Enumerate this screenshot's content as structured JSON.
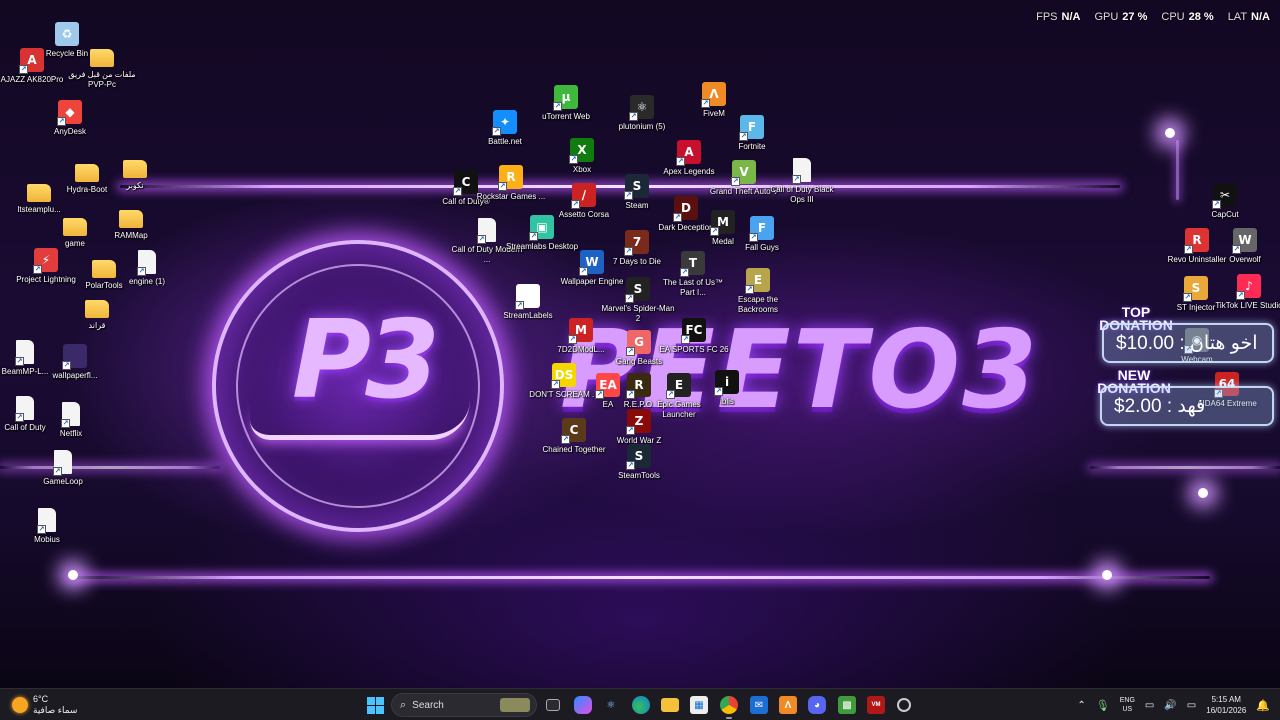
{
  "osd": {
    "fps_label": "FPS",
    "fps_value": "N/A",
    "gpu_label": "GPU",
    "gpu_value": "27 %",
    "cpu_label": "CPU",
    "cpu_value": "28 %",
    "lat_label": "LAT",
    "lat_value": "N/A"
  },
  "wallpaper": {
    "logo": "P3",
    "banner": "PEETO3"
  },
  "donations": {
    "top_title_1": "TOP",
    "top_title_2": "DONATION",
    "top_text": "اخو هتان : 10.00$",
    "new_title_1": "NEW",
    "new_title_2": "DONATION",
    "new_text": "فهد : 2.00$"
  },
  "desktop_icons": [
    {
      "label": "Recycle Bin",
      "icon": "recycle-bin-icon",
      "color": "#9ec9ea",
      "glyph": "♻"
    },
    {
      "label": "ملفات من قبل فريق PVP-Pc",
      "icon": "folder-icon",
      "color": "#f0b43a",
      "glyph": ""
    },
    {
      "label": "AJAZZ AK820Pro",
      "icon": "ajazz-icon",
      "color": "#d93232",
      "glyph": "A"
    },
    {
      "label": "AnyDesk",
      "icon": "anydesk-icon",
      "color": "#ef443b",
      "glyph": "◆"
    },
    {
      "label": "Hydra-Boot",
      "icon": "folder-icon",
      "color": "#f0b43a",
      "glyph": ""
    },
    {
      "label": "نكوبر",
      "icon": "folder-icon",
      "color": "#f0b43a",
      "glyph": ""
    },
    {
      "label": "Itsteamplu...",
      "icon": "folder-icon",
      "color": "#f0b43a",
      "glyph": ""
    },
    {
      "label": "game",
      "icon": "folder-icon",
      "color": "#f0b43a",
      "glyph": ""
    },
    {
      "label": "RAMMap",
      "icon": "folder-icon",
      "color": "#f0b43a",
      "glyph": ""
    },
    {
      "label": "Project Lightning",
      "icon": "project-lightning-icon",
      "color": "#e23d3d",
      "glyph": "⚡"
    },
    {
      "label": "PolarTools",
      "icon": "folder-icon",
      "color": "#f0b43a",
      "glyph": ""
    },
    {
      "label": "engine (1)",
      "icon": "file-icon",
      "color": "#f4f4f4",
      "glyph": ""
    },
    {
      "label": "قراند",
      "icon": "folder-icon",
      "color": "#f0b43a",
      "glyph": ""
    },
    {
      "label": "BeamMP-L...",
      "icon": "file-icon",
      "color": "#f4f4f4",
      "glyph": ""
    },
    {
      "label": "wallpaperfl...",
      "icon": "wallpaper-image-icon",
      "color": "#3a2a6a",
      "glyph": ""
    },
    {
      "label": "Call of Duty",
      "icon": "file-icon",
      "color": "#f4f4f4",
      "glyph": ""
    },
    {
      "label": "Netflix",
      "icon": "file-icon",
      "color": "#f4f4f4",
      "glyph": ""
    },
    {
      "label": "GameLoop",
      "icon": "file-icon",
      "color": "#f4f4f4",
      "glyph": ""
    },
    {
      "label": "Mobius",
      "icon": "file-icon",
      "color": "#f4f4f4",
      "glyph": ""
    },
    {
      "label": "uTorrent Web",
      "icon": "utorrent-icon",
      "color": "#3fb93c",
      "glyph": "µ"
    },
    {
      "label": "plutonium (5)",
      "icon": "plutonium-icon",
      "color": "#2a2a2a",
      "glyph": "⚛"
    },
    {
      "label": "FiveM",
      "icon": "fivem-icon",
      "color": "#f08a24",
      "glyph": "Λ"
    },
    {
      "label": "Battle.net",
      "icon": "battlenet-icon",
      "color": "#148eff",
      "glyph": "✦"
    },
    {
      "label": "Fortnite",
      "icon": "fortnite-icon",
      "color": "#5bb8e8",
      "glyph": "F"
    },
    {
      "label": "Xbox",
      "icon": "xbox-icon",
      "color": "#107c10",
      "glyph": "X"
    },
    {
      "label": "Apex Legends",
      "icon": "apex-icon",
      "color": "#c8102e",
      "glyph": "A"
    },
    {
      "label": "Call of Duty®",
      "icon": "cod-icon",
      "color": "#111111",
      "glyph": "C"
    },
    {
      "label": "Rockstar Games ...",
      "icon": "rockstar-icon",
      "color": "#fcaf17",
      "glyph": "R"
    },
    {
      "label": "Assetto Corsa",
      "icon": "assetto-icon",
      "color": "#c22",
      "glyph": "/"
    },
    {
      "label": "Steam",
      "icon": "steam-icon",
      "color": "#1b2838",
      "glyph": "S"
    },
    {
      "label": "Grand Theft Auto V",
      "icon": "gta-icon",
      "color": "#7ab648",
      "glyph": "V"
    },
    {
      "label": "Call of Duty Black Ops III",
      "icon": "file-icon",
      "color": "#f4f4f4",
      "glyph": ""
    },
    {
      "label": "Call of Duty Modern ...",
      "icon": "file-icon",
      "color": "#f4f4f4",
      "glyph": ""
    },
    {
      "label": "Streamlabs Desktop",
      "icon": "streamlabs-icon",
      "color": "#31c3a2",
      "glyph": "▣"
    },
    {
      "label": "Dark Deception",
      "icon": "dark-deception-icon",
      "color": "#5a1010",
      "glyph": "D"
    },
    {
      "label": "Medal",
      "icon": "medal-icon",
      "color": "#222",
      "glyph": "M"
    },
    {
      "label": "Fall Guys",
      "icon": "fallguys-icon",
      "color": "#4aa3f0",
      "glyph": "F"
    },
    {
      "label": "Wallpaper Engine",
      "icon": "wallpaper-engine-icon",
      "color": "#1e63c4",
      "glyph": "W"
    },
    {
      "label": "7 Days to Die",
      "icon": "7dtd-icon",
      "color": "#7a2a1a",
      "glyph": "7"
    },
    {
      "label": "The Last of Us™ Part I...",
      "icon": "tlou-icon",
      "color": "#3a3a3a",
      "glyph": "T"
    },
    {
      "label": "StreamLabels",
      "icon": "streamlabels-icon",
      "color": "#ffffff",
      "glyph": "▣"
    },
    {
      "label": "Marvel's Spider-Man 2",
      "icon": "spiderman-icon",
      "color": "#222",
      "glyph": "S"
    },
    {
      "label": "Escape the Backrooms",
      "icon": "backrooms-icon",
      "color": "#b8a44a",
      "glyph": "E"
    },
    {
      "label": "7D2DModL...",
      "icon": "7d2dmodl-icon",
      "color": "#c22",
      "glyph": "M"
    },
    {
      "label": "Gang Beasts",
      "icon": "gangbeasts-icon",
      "color": "#e66",
      "glyph": "G"
    },
    {
      "label": "EA SPORTS FC 26",
      "icon": "eafc-icon",
      "color": "#111",
      "glyph": "FC"
    },
    {
      "label": "DON'T SCREAM ...",
      "icon": "dontscream-icon",
      "color": "#f6d600",
      "glyph": "DS"
    },
    {
      "label": "EA",
      "icon": "ea-icon",
      "color": "#ff4747",
      "glyph": "EA"
    },
    {
      "label": "R.E.P.O.",
      "icon": "repo-icon",
      "color": "#3a2a10",
      "glyph": "R"
    },
    {
      "label": "Epic Games Launcher",
      "icon": "epic-icon",
      "color": "#222",
      "glyph": "E"
    },
    {
      "label": "iblis",
      "icon": "iblis-icon",
      "color": "#111",
      "glyph": "i"
    },
    {
      "label": "World War Z",
      "icon": "wwz-icon",
      "color": "#8a0a0a",
      "glyph": "Z"
    },
    {
      "label": "Chained Together",
      "icon": "chained-icon",
      "color": "#5a3a1a",
      "glyph": "C"
    },
    {
      "label": "SteamTools",
      "icon": "steamtools-icon",
      "color": "#1b2838",
      "glyph": "S"
    },
    {
      "label": "CapCut",
      "icon": "capcut-icon",
      "color": "#111",
      "glyph": "✂"
    },
    {
      "label": "Revo Uninstaller",
      "icon": "revo-icon",
      "color": "#d33",
      "glyph": "R"
    },
    {
      "label": "Overwolf",
      "icon": "overwolf-icon",
      "color": "#666",
      "glyph": "W"
    },
    {
      "label": "ST Injector",
      "icon": "stinjector-icon",
      "color": "#e8a93a",
      "glyph": "S"
    },
    {
      "label": "TikTok LIVE Studio",
      "icon": "tiktok-icon",
      "color": "#fe2c55",
      "glyph": "♪"
    },
    {
      "label": "Webcam",
      "icon": "webcam-icon",
      "color": "#666",
      "glyph": "◉"
    },
    {
      "label": "AIDA64 Extreme",
      "icon": "aida64-icon",
      "color": "#c22",
      "glyph": "64"
    }
  ],
  "taskbar": {
    "weather_temp": "6°C",
    "weather_desc": "سماء صافية",
    "search_placeholder": "Search",
    "lang_1": "ENG",
    "lang_2": "US",
    "time": "5:15 AM",
    "date": "16/01/2026"
  }
}
